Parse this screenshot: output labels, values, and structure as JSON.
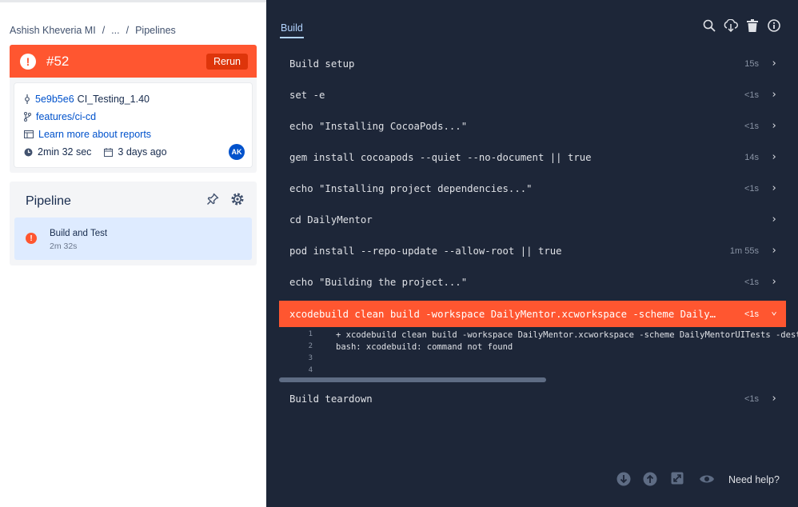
{
  "breadcrumb": {
    "workspace": "Ashish Kheveria MI",
    "sep": "/",
    "ellipsis": "...",
    "page": "Pipelines"
  },
  "build": {
    "number": "#52",
    "status": "failed",
    "rerun_label": "Rerun",
    "commit_hash": "5e9b5e6",
    "commit_message": "CI_Testing_1.40",
    "branch": "features/ci-cd",
    "reports_link": "Learn more about reports",
    "duration": "2min 32 sec",
    "when": "3 days ago",
    "avatar_initials": "AK"
  },
  "pipeline": {
    "title": "Pipeline",
    "step": {
      "name": "Build and Test",
      "duration": "2m 32s"
    }
  },
  "log": {
    "tab_label": "Build",
    "steps": [
      {
        "cmd": "Build setup",
        "dur": "15s",
        "chev": "›"
      },
      {
        "cmd": "set -e",
        "dur": "<1s",
        "chev": "›"
      },
      {
        "cmd": "echo \"Installing CocoaPods...\"",
        "dur": "<1s",
        "chev": "›"
      },
      {
        "cmd": "gem install cocoapods --quiet --no-document || true",
        "dur": "14s",
        "chev": "›"
      },
      {
        "cmd": "echo \"Installing project dependencies...\"",
        "dur": "<1s",
        "chev": "›"
      },
      {
        "cmd": "cd DailyMentor",
        "dur": "",
        "chev": "›"
      },
      {
        "cmd": "pod install --repo-update --allow-root || true",
        "dur": "1m 55s",
        "chev": "›"
      },
      {
        "cmd": "echo \"Building the project...\"",
        "dur": "<1s",
        "chev": "›"
      },
      {
        "cmd": "xcodebuild clean build -workspace DailyMentor.xcworkspace -scheme DailyMentorUITests -destination",
        "dur": "<1s",
        "chev": "⌄"
      },
      {
        "cmd": "Build teardown",
        "dur": "<1s",
        "chev": "›"
      }
    ],
    "output": [
      {
        "n": "1",
        "text": "+ xcodebuild clean build -workspace DailyMentor.xcworkspace -scheme DailyMentorUITests -destination"
      },
      {
        "n": "2",
        "text": "bash: xcodebuild: command not found"
      },
      {
        "n": "3",
        "text": ""
      },
      {
        "n": "4",
        "text": ""
      }
    ]
  },
  "footer": {
    "help_label": "Need help?"
  },
  "colors": {
    "error": "#ff5630",
    "dark_bg": "#1d2638",
    "link": "#0052cc",
    "selected": "#deebff"
  },
  "icons": [
    "search-icon",
    "download-icon",
    "trash-icon",
    "info-icon",
    "pin-icon",
    "gear-icon",
    "scroll-down-icon",
    "scroll-up-icon",
    "expand-icon",
    "eye-icon"
  ]
}
